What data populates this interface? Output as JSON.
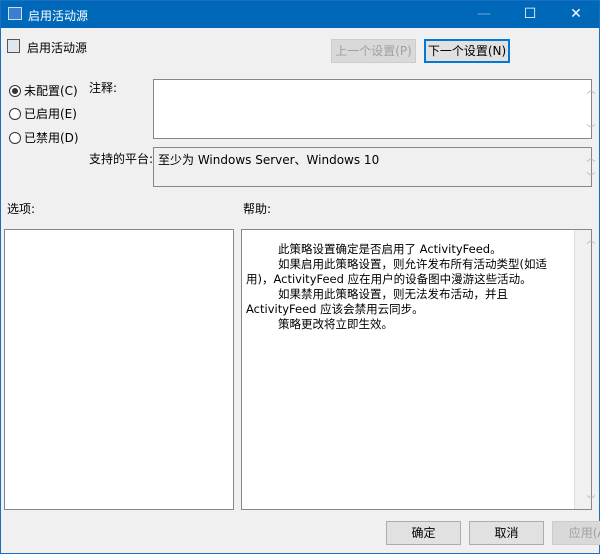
{
  "window": {
    "title": "启用活动源",
    "minimize": "—",
    "maximize": "☐",
    "close": "✕"
  },
  "header": {
    "policy_name": "启用活动源",
    "prev_button": "上一个设置(P)",
    "next_button": "下一个设置(N)"
  },
  "radios": [
    {
      "label": "未配置(C)",
      "checked": true
    },
    {
      "label": "已启用(E)",
      "checked": false
    },
    {
      "label": "已禁用(D)",
      "checked": false
    }
  ],
  "comment": {
    "label": "注释:",
    "value": ""
  },
  "platform": {
    "label": "支持的平台:",
    "value": "至少为 Windows Server、Windows 10"
  },
  "options": {
    "label": "选项:"
  },
  "help": {
    "label": "帮助:",
    "paragraphs": [
      "此策略设置确定是否启用了 ActivityFeed。",
      "如果启用此策略设置，则允许发布所有活动类型(如适用)，ActivityFeed 应在用户的设备图中漫游这些活动。",
      "如果禁用此策略设置，则无法发布活动，并且 ActivityFeed 应该会禁用云同步。",
      "策略更改将立即生效。"
    ]
  },
  "footer": {
    "ok": "确定",
    "cancel": "取消",
    "apply": "应用(A)"
  },
  "colors": {
    "titlebar": "#0068b8",
    "focus": "#0078d7"
  }
}
